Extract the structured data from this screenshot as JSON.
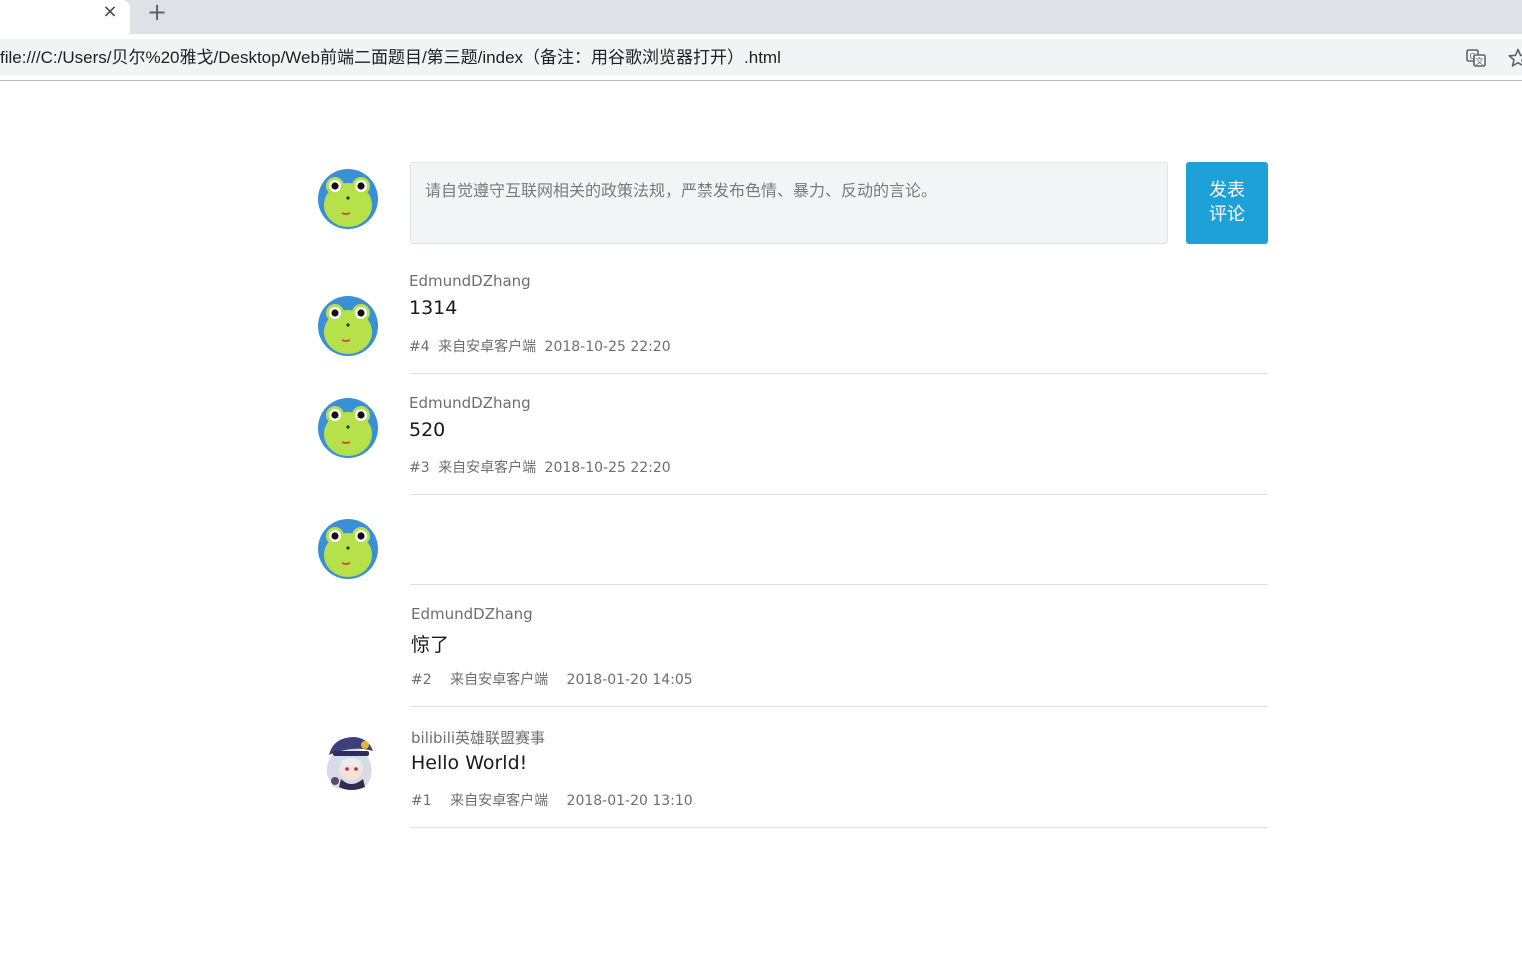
{
  "browser": {
    "tab_close_icon": "×",
    "new_tab_icon": "+",
    "url": "file:///C:/Users/贝尔%20雅戈/Desktop/Web前端二面题目/第三题/index（备注：用谷歌浏览器打开）.html"
  },
  "editor": {
    "placeholder": "请自觉遵守互联网相关的政策法规，严禁发布色情、暴力、反动的言论。",
    "submit_line1": "发表",
    "submit_line2": "评论"
  },
  "comments": [
    {
      "user": "EdmundDZhang",
      "text": "1314",
      "floor": "#4",
      "source": "来自安卓客户端",
      "time": "2018-10-25 22:20",
      "avatar": "frog"
    },
    {
      "user": "EdmundDZhang",
      "text": "520",
      "floor": "#3",
      "source": "来自安卓客户端",
      "time": "2018-10-25 22:20",
      "avatar": "frog"
    },
    {
      "user": "",
      "text": "",
      "floor": "",
      "source": "",
      "time": "",
      "avatar": "frog"
    },
    {
      "user": "EdmundDZhang",
      "text": "惊了",
      "floor": "#2",
      "source": "来自安卓客户端",
      "time": "2018-01-20 14:05",
      "avatar": "none"
    },
    {
      "user": "bilibili英雄联盟赛事",
      "text": "Hello World!",
      "floor": "#1",
      "source": "来自安卓客户端",
      "time": "2018-01-20 13:10",
      "avatar": "anime"
    }
  ],
  "colors": {
    "accent": "#1da1d8",
    "frog_ring": "#3a8fd6",
    "frog_face": "#b7e14a"
  }
}
